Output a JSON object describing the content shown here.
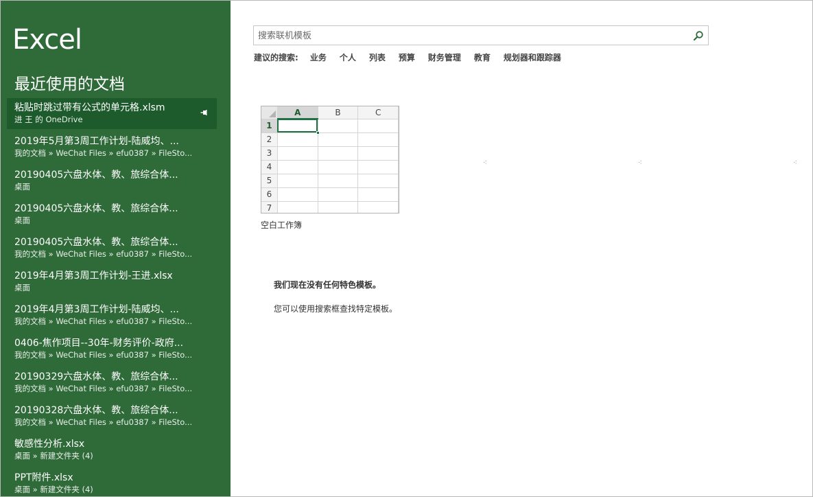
{
  "app": {
    "title": "Excel"
  },
  "sidebar": {
    "heading": "最近使用的文档",
    "items": [
      {
        "name": "粘贴时跳过带有公式的单元格.xlsm",
        "path": "进 王 的 OneDrive",
        "selected": true
      },
      {
        "name": "2019年5月第3周工作计划-陆威均、...",
        "path": "我的文档 » WeChat Files » efu0387 » FileSto..."
      },
      {
        "name": "20190405六盘水体、教、旅综合体...",
        "path": "桌面"
      },
      {
        "name": "20190405六盘水体、教、旅综合体...",
        "path": "桌面"
      },
      {
        "name": "20190405六盘水体、教、旅综合体...",
        "path": "我的文档 » WeChat Files » efu0387 » FileSto..."
      },
      {
        "name": "2019年4月第3周工作计划-王进.xlsx",
        "path": "桌面"
      },
      {
        "name": "2019年4月第3周工作计划-陆威均、...",
        "path": "我的文档 » WeChat Files » efu0387 » FileSto..."
      },
      {
        "name": "0406-焦作项目--30年-财务评价-政府...",
        "path": "我的文档 » WeChat Files » efu0387 » FileSto..."
      },
      {
        "name": "20190329六盘水体、教、旅综合体...",
        "path": "我的文档 » WeChat Files » efu0387 » FileSto..."
      },
      {
        "name": "20190328六盘水体、教、旅综合体...",
        "path": "我的文档 » WeChat Files » efu0387 » FileSto..."
      },
      {
        "name": "敏感性分析.xlsx",
        "path": "桌面 » 新建文件夹 (4)"
      },
      {
        "name": "PPT附件.xlsx",
        "path": "桌面 » 新建文件夹 (4)"
      }
    ]
  },
  "search": {
    "placeholder": "搜索联机模板",
    "value": ""
  },
  "suggested": {
    "label": "建议的搜索:",
    "links": [
      "业务",
      "个人",
      "列表",
      "预算",
      "财务管理",
      "教育",
      "规划器和跟踪器"
    ]
  },
  "blank_workbook": {
    "label": "空白工作簿",
    "columns": [
      "A",
      "B",
      "C"
    ],
    "rows": [
      "1",
      "2",
      "3",
      "4",
      "5",
      "6",
      "7"
    ]
  },
  "messages": {
    "no_templates": "我们现在没有任何特色模板。",
    "hint": "您可以使用搜索框查找特定模板。"
  },
  "colors": {
    "sidebar": "#2f6a39",
    "selected": "#1e5b2c",
    "accent": "#1e7145"
  }
}
